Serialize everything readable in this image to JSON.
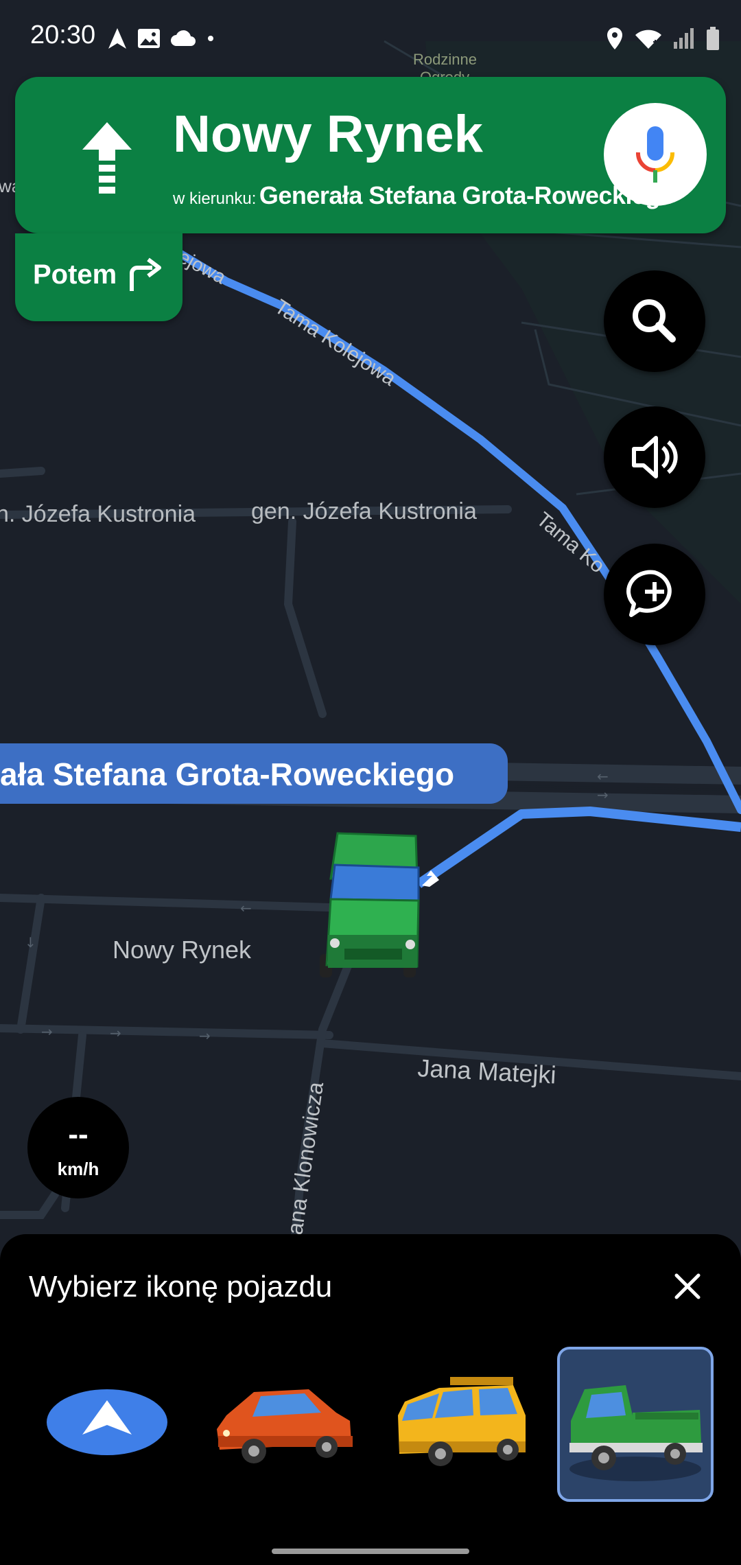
{
  "status_bar": {
    "time": "20:30",
    "left_icons": [
      "navigation-icon",
      "image-icon",
      "cloud-icon",
      "dot-icon"
    ],
    "right_icons": [
      "location-icon",
      "wifi-icon",
      "signal-icon",
      "battery-icon"
    ]
  },
  "navigation": {
    "street": "Nowy Rynek",
    "toward_prefix": "w kierunku:",
    "toward_street": "Generała Stefana Grota-Roweckiego",
    "maneuver_icon": "arrow-straight-icon",
    "then_label": "Potem",
    "then_icon": "turn-right-icon",
    "mic_icon": "microphone-icon"
  },
  "map": {
    "labels": {
      "rodzinne": "Rodzinne",
      "rodzinne_line2": "Ogrody",
      "tama_kolejowa_top": "ejowa",
      "tama_kolejowa_mid": "Tama Kolejowa",
      "tama_kolejowa_right": "Tama Ko",
      "kustronia_left": "n. Józefa Kustronia",
      "kustronia_right": "gen. Józefa Kustronia",
      "nowy_rynek": "Nowy Rynek",
      "jana_matejki": "Jana Matejki",
      "klonowicza": "ana Klonowicza",
      "edge_wa": "wa"
    },
    "current_street_banner": "ała Stefana Grota-Roweckiego",
    "route_color": "#4a8cf0",
    "vehicle_icon": "pickup-truck-icon"
  },
  "controls": {
    "search_icon": "search-icon",
    "sound_icon": "volume-icon",
    "report_icon": "add-report-icon"
  },
  "speedometer": {
    "value": "--",
    "unit": "km/h"
  },
  "vehicle_sheet": {
    "title": "Wybierz ikonę pojazdu",
    "close_icon": "close-icon",
    "options": [
      {
        "name": "navigation-arrow",
        "selected": false
      },
      {
        "name": "red-car",
        "selected": false
      },
      {
        "name": "yellow-suv",
        "selected": false
      },
      {
        "name": "green-pickup",
        "selected": true
      }
    ]
  }
}
